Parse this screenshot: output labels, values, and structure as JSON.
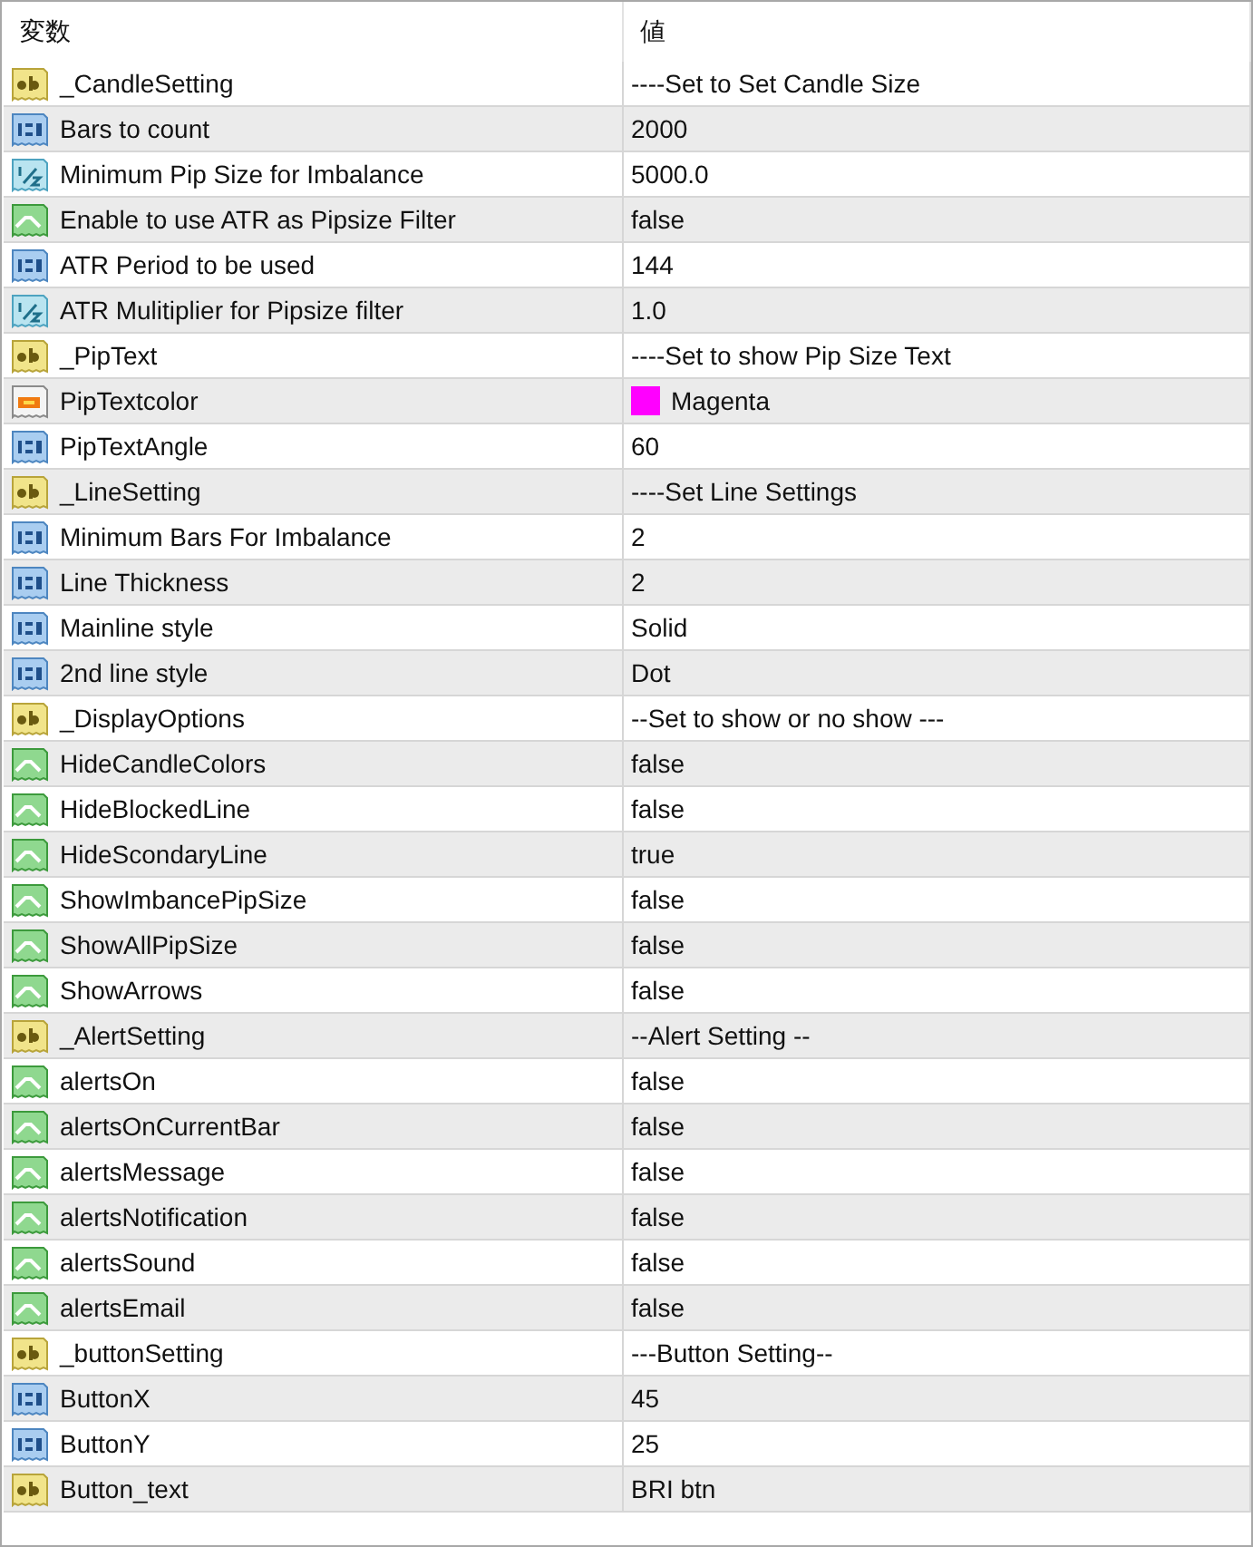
{
  "columns": [
    "変数",
    "値"
  ],
  "rows": [
    {
      "kind": "string",
      "name": "_CandleSetting",
      "value": "----Set to Set Candle Size"
    },
    {
      "kind": "int",
      "name": "Bars to count",
      "value": "2000"
    },
    {
      "kind": "double",
      "name": "Minimum Pip Size for Imbalance",
      "value": "5000.0"
    },
    {
      "kind": "bool",
      "name": "Enable to use ATR as Pipsize Filter",
      "value": "false"
    },
    {
      "kind": "int",
      "name": "ATR Period to be used",
      "value": "144"
    },
    {
      "kind": "double",
      "name": "ATR Mulitiplier for Pipsize filter",
      "value": "1.0"
    },
    {
      "kind": "string",
      "name": "_PipText",
      "value": "----Set to show Pip Size Text"
    },
    {
      "kind": "color",
      "name": "PipTextcolor",
      "value": "Magenta",
      "color": "#ff00ff"
    },
    {
      "kind": "int",
      "name": "PipTextAngle",
      "value": "60"
    },
    {
      "kind": "string",
      "name": "_LineSetting",
      "value": "----Set Line Settings"
    },
    {
      "kind": "int",
      "name": "Minimum Bars For Imbalance",
      "value": "2"
    },
    {
      "kind": "int",
      "name": "Line Thickness",
      "value": "2"
    },
    {
      "kind": "int",
      "name": "Mainline style",
      "value": "Solid"
    },
    {
      "kind": "int",
      "name": "2nd line style",
      "value": "Dot"
    },
    {
      "kind": "string",
      "name": "_DisplayOptions",
      "value": "--Set to show or no show ---"
    },
    {
      "kind": "bool",
      "name": "HideCandleColors",
      "value": "false"
    },
    {
      "kind": "bool",
      "name": "HideBlockedLine",
      "value": "false"
    },
    {
      "kind": "bool",
      "name": "HideScondaryLine",
      "value": "true"
    },
    {
      "kind": "bool",
      "name": "ShowImbancePipSize",
      "value": "false"
    },
    {
      "kind": "bool",
      "name": "ShowAllPipSize",
      "value": "false"
    },
    {
      "kind": "bool",
      "name": "ShowArrows",
      "value": "false"
    },
    {
      "kind": "string",
      "name": "_AlertSetting",
      "value": "--Alert Setting --"
    },
    {
      "kind": "bool",
      "name": "alertsOn",
      "value": "false"
    },
    {
      "kind": "bool",
      "name": "alertsOnCurrentBar",
      "value": "false"
    },
    {
      "kind": "bool",
      "name": "alertsMessage",
      "value": "false"
    },
    {
      "kind": "bool",
      "name": "alertsNotification",
      "value": "false"
    },
    {
      "kind": "bool",
      "name": "alertsSound",
      "value": "false"
    },
    {
      "kind": "bool",
      "name": "alertsEmail",
      "value": "false"
    },
    {
      "kind": "string",
      "name": "_buttonSetting",
      "value": "---Button Setting--"
    },
    {
      "kind": "int",
      "name": "ButtonX",
      "value": "45"
    },
    {
      "kind": "int",
      "name": "ButtonY",
      "value": "25"
    },
    {
      "kind": "string",
      "name": "Button_text",
      "value": "BRI btn"
    }
  ]
}
